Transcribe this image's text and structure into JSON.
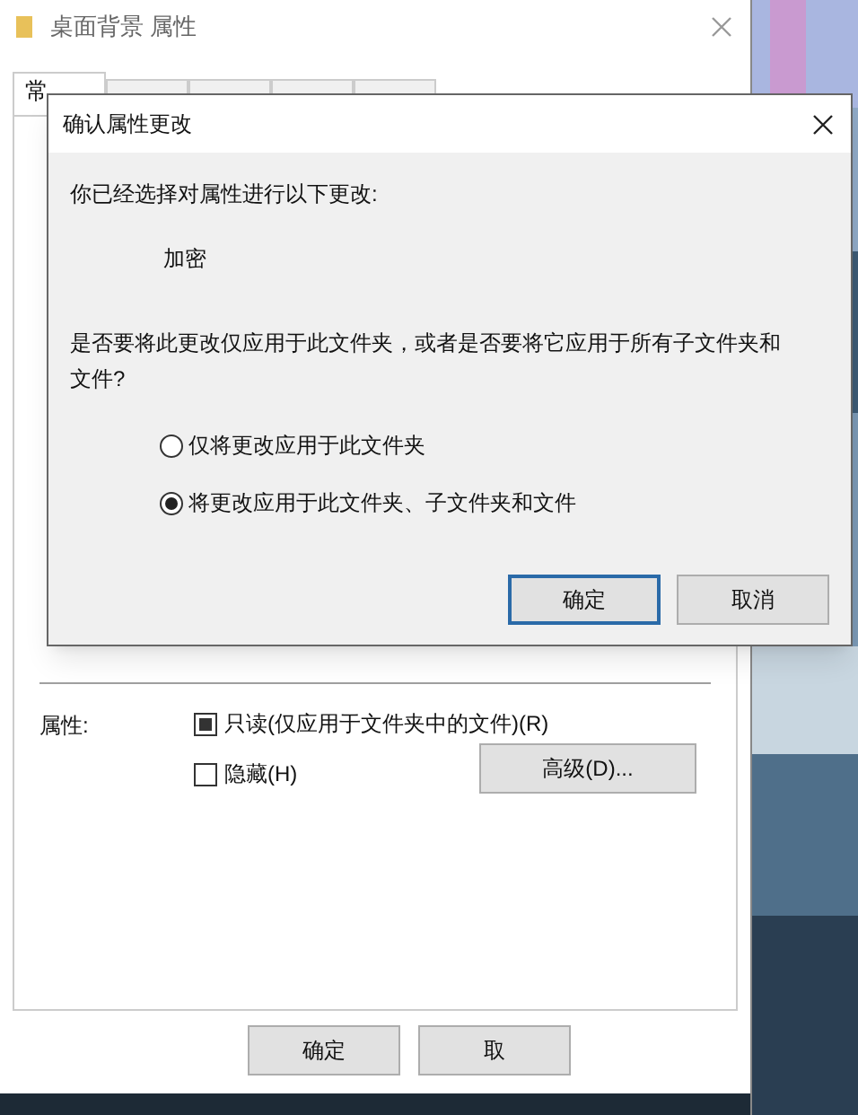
{
  "properties_window": {
    "title": "桌面背景 属性",
    "tabs": [
      {
        "label": "常",
        "selected": true
      },
      {
        "selected": false
      },
      {
        "selected": false
      },
      {
        "selected": false
      },
      {
        "selected": false
      }
    ],
    "attributes_label": "属性:",
    "checkboxes": [
      {
        "label": "只读(仅应用于文件夹中的文件)(R)",
        "indeterminate": true
      },
      {
        "label": "隐藏(H)",
        "indeterminate": false
      }
    ],
    "advanced_button": "高级(D)...",
    "buttons": [
      "确定",
      "取"
    ]
  },
  "dialog": {
    "title": "确认属性更改",
    "intro": "你已经选择对属性进行以下更改:",
    "change": "加密",
    "question": "是否要将此更改仅应用于此文件夹，或者是否要将它应用于所有子文件夹和文件?",
    "options": [
      {
        "label": "仅将更改应用于此文件夹",
        "selected": false
      },
      {
        "label": "将更改应用于此文件夹、子文件夹和文件",
        "selected": true
      }
    ],
    "buttons": [
      {
        "label": "确定",
        "default": true
      },
      {
        "label": "取消",
        "default": false
      }
    ]
  }
}
